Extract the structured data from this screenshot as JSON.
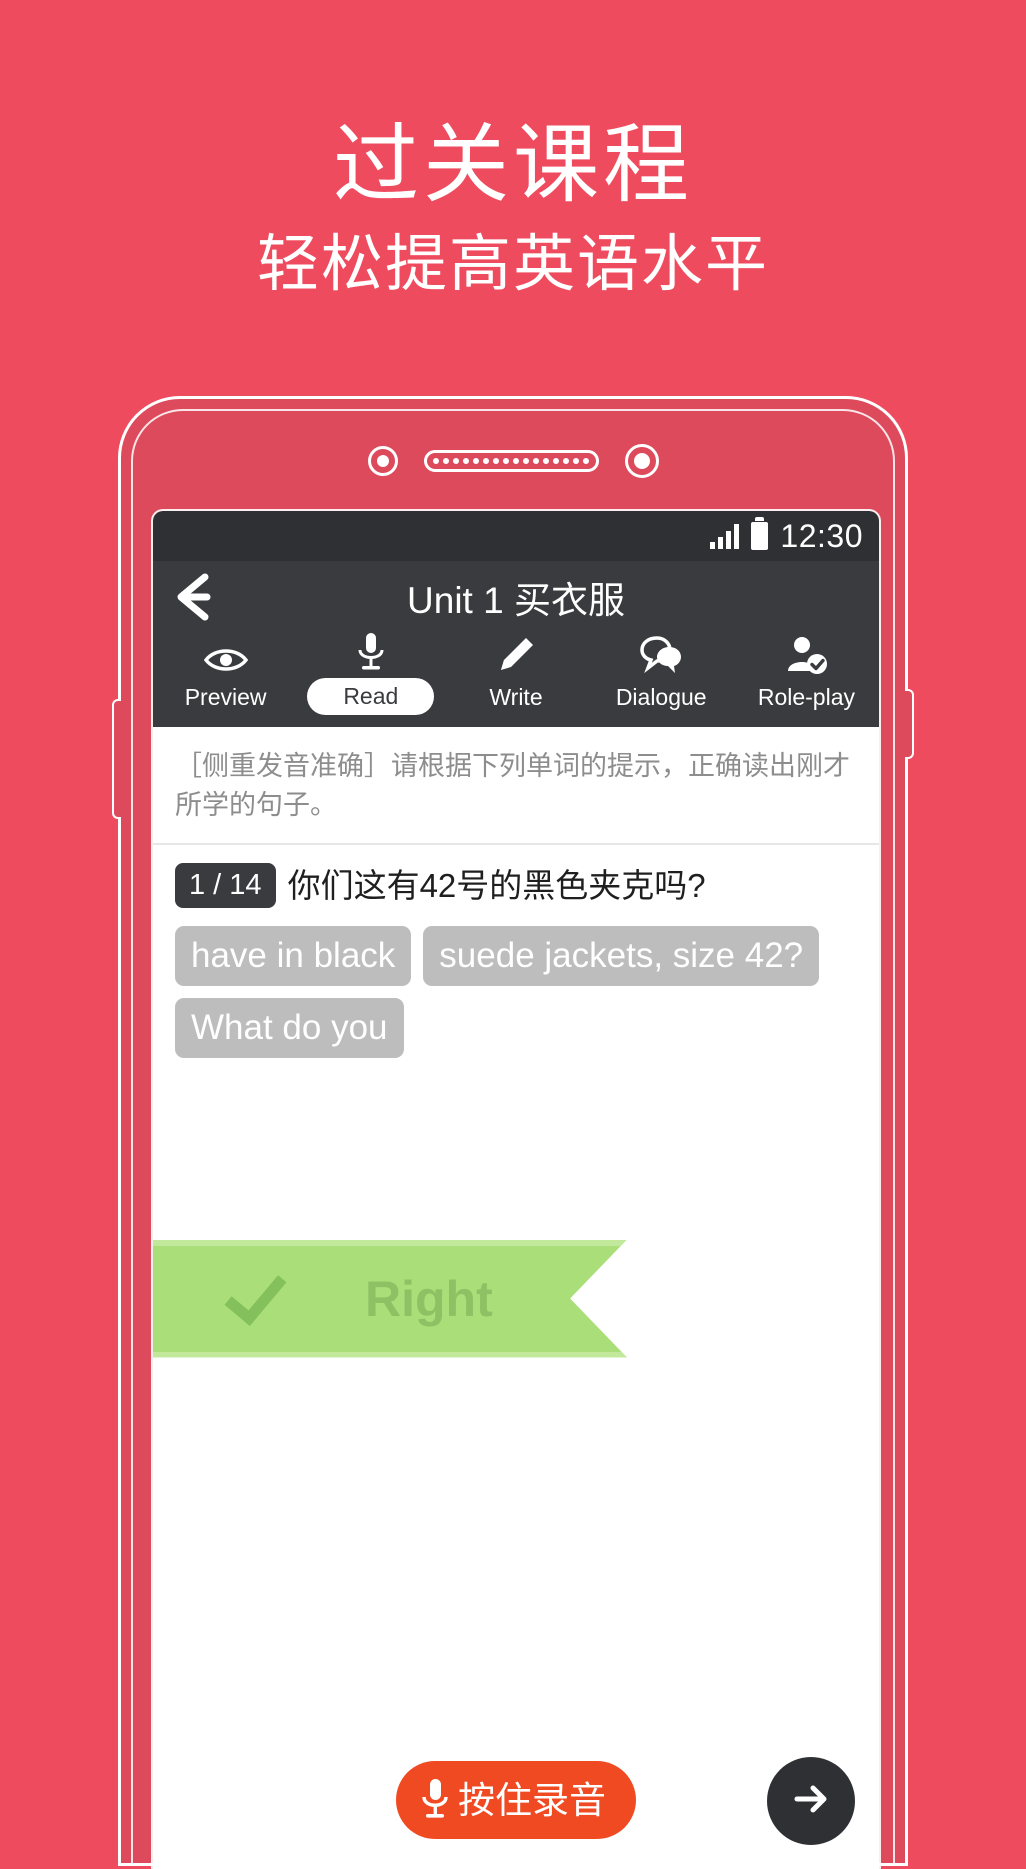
{
  "promo": {
    "title": "过关课程",
    "subtitle": "轻松提高英语水平"
  },
  "colors": {
    "background_red": "#ef4b5e",
    "phone_body": "#dc4a5c",
    "appbar_dark": "#3a3b3e",
    "statusbar_dark": "#2f3033",
    "chip_gray": "#bdbdbd",
    "ribbon_green": "#aade79",
    "ribbon_text_green": "#8ec163",
    "record_orange": "#f04a23"
  },
  "phone": {
    "status_bar": {
      "time": "12:30",
      "signal_icon": "signal-bars-icon",
      "battery_icon": "battery-full-icon"
    },
    "app_bar": {
      "back_icon": "back-arrow-icon",
      "title": "Unit 1 买衣服"
    },
    "tabs": [
      {
        "label": "Preview",
        "icon": "eye-icon",
        "active": false
      },
      {
        "label": "Read",
        "icon": "microphone-icon",
        "active": true
      },
      {
        "label": "Write",
        "icon": "pencil-icon",
        "active": false
      },
      {
        "label": "Dialogue",
        "icon": "speech-bubbles-icon",
        "active": false
      },
      {
        "label": "Role-play",
        "icon": "person-check-icon",
        "active": false
      }
    ],
    "instruction": "［侧重发音准确］请根据下列单词的提示，正确读出刚才所学的句子。",
    "question": {
      "counter": "1 / 14",
      "prompt": "你们这有42号的黑色夹克吗?"
    },
    "chips": [
      "have in black",
      "suede jackets, size 42?",
      "What do you"
    ],
    "result": {
      "label": "Right",
      "icon": "check-icon"
    },
    "bottom": {
      "record_label": "按住录音",
      "record_icon": "microphone-icon",
      "next_icon": "arrow-right-icon"
    }
  }
}
